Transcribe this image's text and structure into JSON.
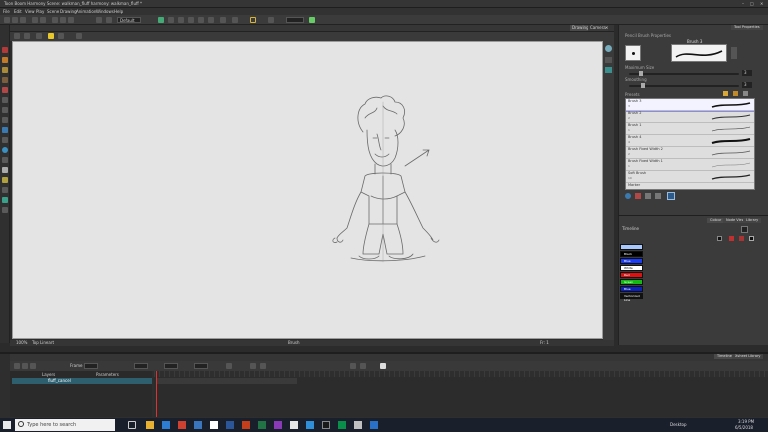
{
  "window": {
    "title": "Toon Boom Harmony Scene: walkman_fluff  harmony: walkman_fluff *"
  },
  "menu": [
    "File",
    "Edit",
    "View",
    "Play",
    "Scene",
    "Drawing",
    "Animation",
    "Windows",
    "Help"
  ],
  "toolbar": {
    "preset_select": "Default"
  },
  "view": {
    "tabs": [
      "Drawing",
      "Camera"
    ],
    "status_zoom": "100%",
    "status_mode": "Top Lineart",
    "status_center": "Brush",
    "status_frame": "Fr: 1"
  },
  "tool_properties": {
    "panel_tab": "Tool Properties",
    "header": "Pencil Brush Properties",
    "preview_label": "Brush 3",
    "max_size_label": "Maximum Size",
    "max_size_value": "3",
    "smoothing_label": "Smoothing",
    "smoothing_value": "3",
    "presets_label": "Presets",
    "brushes": [
      {
        "name": "Brush 3",
        "size": "3",
        "selected": true
      },
      {
        "name": "Brush 2",
        "size": "2",
        "selected": false
      },
      {
        "name": "Brush 1",
        "size": "1",
        "selected": false
      },
      {
        "name": "Brush 4",
        "size": "4",
        "selected": false
      },
      {
        "name": "Brush Fixed Width 2",
        "size": "2",
        "selected": false
      },
      {
        "name": "Brush Fixed Width 1",
        "size": "1",
        "selected": false
      },
      {
        "name": "Soft Brush",
        "size": "10",
        "selected": false
      },
      {
        "name": "Marker",
        "size": "",
        "selected": false
      }
    ]
  },
  "colour_panel": {
    "tabs": [
      "Colour",
      "Node View",
      "Library"
    ],
    "palette_name": "Timeline",
    "swatches": [
      {
        "name": "",
        "color": "#a6c8ff"
      },
      {
        "name": "Black",
        "color": "#000000"
      },
      {
        "name": "Blue",
        "color": "#1a3cff"
      },
      {
        "name": "White",
        "color": "#ffffff"
      },
      {
        "name": "Red",
        "color": "#e01010"
      },
      {
        "name": "Green",
        "color": "#15b815"
      },
      {
        "name": "Blue",
        "color": "#0a20c0"
      },
      {
        "name": "Vectorized Line",
        "color": "#111111"
      }
    ]
  },
  "timeline": {
    "tabs": [
      "Timeline",
      "Xsheet Library"
    ],
    "column_layers": "Layers",
    "column_parameters": "Parameters",
    "fps_label": "Frame",
    "layer_name": "fluff_cancel"
  },
  "taskbar": {
    "search_placeholder": "Type here to search",
    "tray_label": "Desktop",
    "time": "3:19 PM",
    "date": "6/5/2018"
  }
}
